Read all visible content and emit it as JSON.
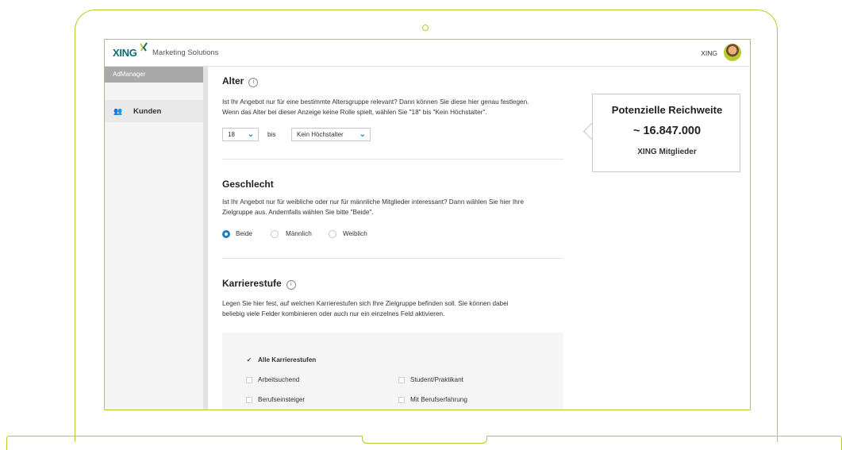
{
  "header": {
    "logo_text": "XING",
    "brand_subtitle": "Marketing Solutions",
    "user_label": "XING",
    "accent_color": "#b4cc2c"
  },
  "sidebar": {
    "section_label": "AdManager",
    "items": [
      {
        "label": "Kunden",
        "icon": "users-icon"
      }
    ]
  },
  "alter": {
    "title": "Alter",
    "description_line1": "Ist Ihr Angebot nur für eine bestimmte Altersgruppe relevant? Dann können Sie diese hier genau festlegen.",
    "description_line2": "Wenn das Alter bei dieser Anzeige keine Rolle spielt, wählen Sie \"18\" bis \"Kein Höchstalter\".",
    "min_value": "18",
    "to_label": "bis",
    "max_value": "Kein Höchstalter"
  },
  "geschlecht": {
    "title": "Geschlecht",
    "description_line1": "Ist Ihr Angebot nur für weibliche oder nur für männliche Mitglieder interessant? Dann wählen Sie hier Ihre",
    "description_line2": "Zielgruppe aus. Andernfalls wählen Sie bitte \"Beide\".",
    "options": [
      "Beide",
      "Männlich",
      "Weiblich"
    ],
    "selected": "Beide"
  },
  "karriere": {
    "title": "Karrierestufe",
    "description_line1": "Legen Sie hier fest, auf welchen Karrierestufen sich Ihre Zielgruppe befinden soll. Sie können dabei",
    "description_line2": "beliebig viele Felder kombinieren oder auch nur ein einzelnes Feld aktivieren.",
    "all_label": "Alle Karrierestufen",
    "options": [
      "Arbeitsuchend",
      "Student/Praktikant",
      "Berufseinsteiger",
      "Mit Berufserfahrung"
    ]
  },
  "reach": {
    "title": "Potenzielle Reichweite",
    "value": "~ 16.847.000",
    "subtitle": "XING Mitglieder"
  }
}
